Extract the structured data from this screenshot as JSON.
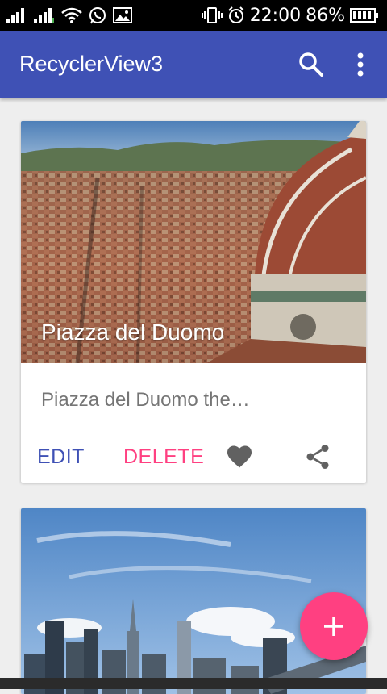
{
  "status_bar": {
    "time": "22:00",
    "battery_percent": "86%",
    "icons": [
      "signal-icon",
      "signal-icon",
      "wifi-icon",
      "whatsapp-icon",
      "image-icon",
      "vibrate-icon",
      "alarm-icon",
      "battery-icon"
    ]
  },
  "app_bar": {
    "title": "RecyclerView3",
    "background": "#3f51b5",
    "actions": [
      "search-icon",
      "more-vert-icon"
    ]
  },
  "cards": [
    {
      "title": "Piazza del Duomo",
      "description": "Piazza del Duomo the…",
      "edit_label": "EDIT",
      "delete_label": "DELETE",
      "favorite_icon": "heart-icon",
      "share_icon": "share-icon"
    }
  ],
  "fab": {
    "icon": "plus-icon",
    "color": "#ff4081"
  },
  "colors": {
    "primary": "#3f51b5",
    "accent": "#ff4081",
    "background": "#eeeeee"
  }
}
